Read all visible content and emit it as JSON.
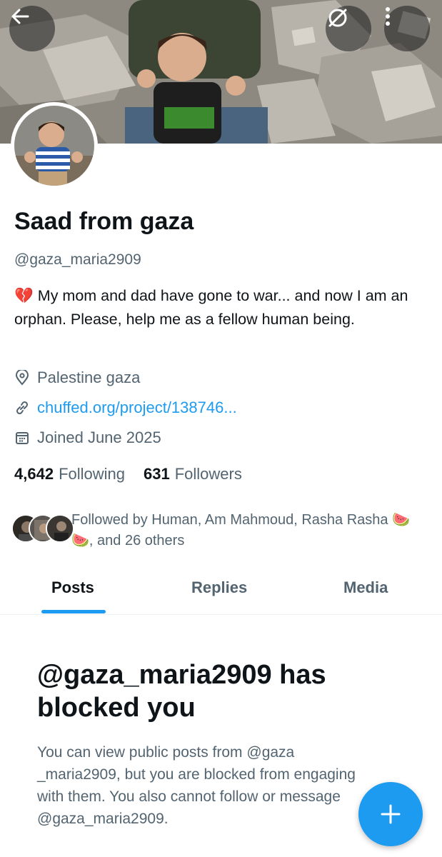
{
  "profile": {
    "display_name": "Saad from gaza",
    "handle": "@gaza_maria2909",
    "bio_emoji": "💔",
    "bio": "My mom and dad have gone to war... and now I am an orphan. Please, help me as a fellow human being.",
    "location": "Palestine gaza",
    "link": "chuffed.org/project/138746...",
    "joined": "Joined June 2025",
    "following_count": "4,642",
    "following_label": "Following",
    "followers_count": "631",
    "followers_label": "Followers",
    "followed_by": "Followed by Human, Am Mahmoud, Rasha Rasha 🍉🍉, and 26 others"
  },
  "tabs": [
    {
      "label": "Posts"
    },
    {
      "label": "Replies"
    },
    {
      "label": "Media"
    }
  ],
  "blocked": {
    "title": "@gaza_maria2909 has blocked you",
    "description": "You can view public posts from @gaza _maria2909, but you are blocked from engaging with them. You also cannot follow or message @gaza_maria2909."
  },
  "icons": {
    "back": "arrow-left-icon",
    "circle": "circle-slash-icon",
    "more": "more-vertical-icon",
    "location": "location-pin-icon",
    "link": "link-icon",
    "calendar": "calendar-icon",
    "compose": "plus-icon"
  },
  "colors": {
    "accent": "#1d9bf0",
    "text_primary": "#0f1419",
    "text_secondary": "#536471"
  }
}
